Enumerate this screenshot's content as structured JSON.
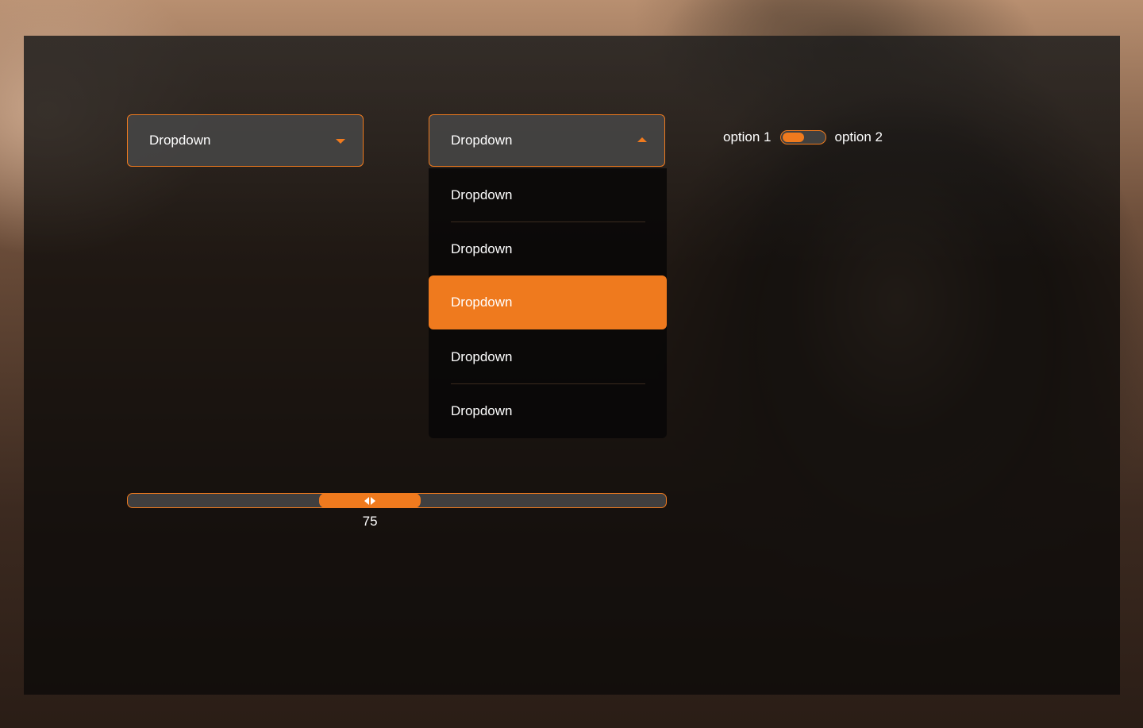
{
  "dropdown_closed": {
    "label": "Dropdown",
    "caret_icon": "caret-down-icon"
  },
  "dropdown_open": {
    "label": "Dropdown",
    "caret_icon": "caret-up-icon",
    "options": [
      "Dropdown",
      "Dropdown",
      "Dropdown",
      "Dropdown",
      "Dropdown"
    ],
    "selected_index": 2
  },
  "toggle": {
    "left_label": "option 1",
    "right_label": "option 2",
    "state": "option 1"
  },
  "slider": {
    "value": "75",
    "handle_icon": "double-arrow-icon",
    "fill_fraction": 0.45
  },
  "colors": {
    "accent": "#ef7a1e",
    "control_bg": "#484848",
    "text": "#ffffff"
  }
}
